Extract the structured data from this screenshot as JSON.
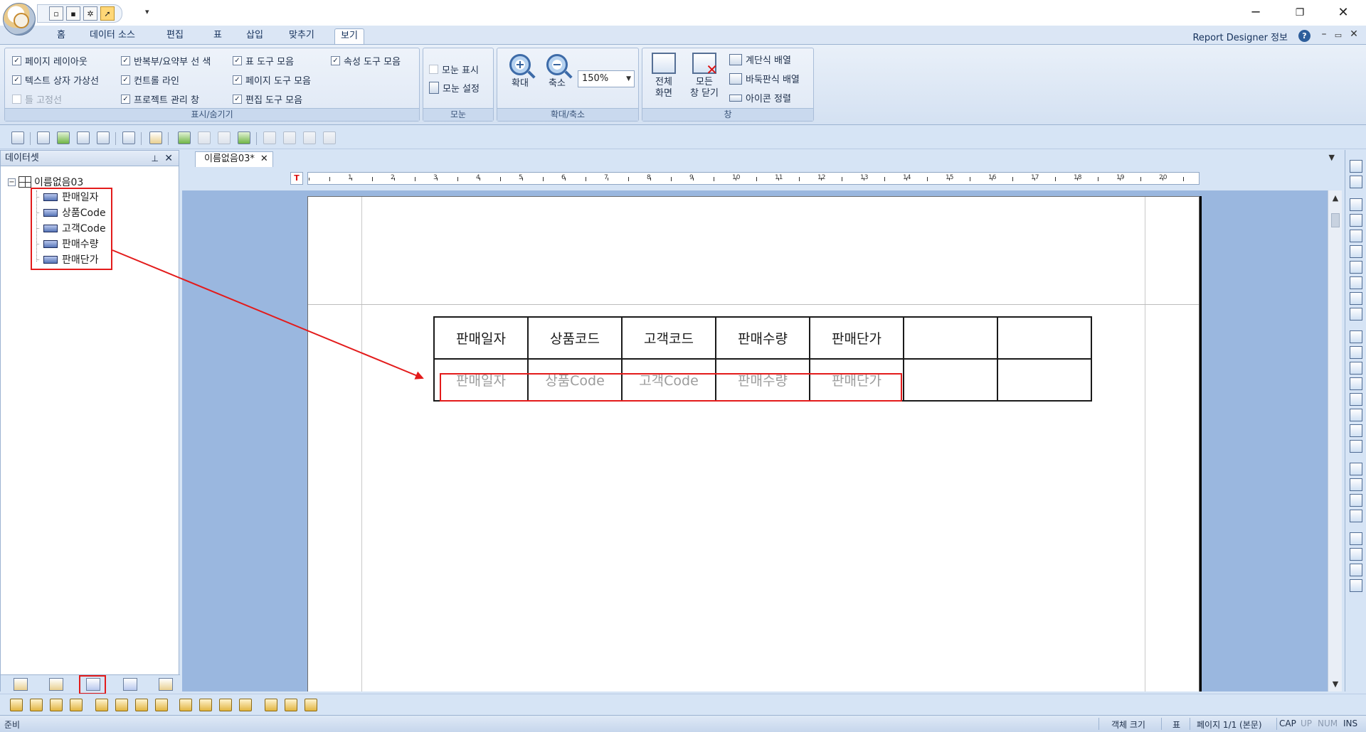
{
  "ribbon": {
    "tabs": [
      "홈",
      "데이터 소스",
      "편집",
      "표",
      "삽입",
      "맞추기",
      "보기"
    ],
    "active_tab": "보기",
    "right_info": "Report Designer 정보",
    "groups": {
      "show_hide": {
        "label": "표시/숨기기",
        "checks": [
          {
            "label": "페이지 레이아웃",
            "checked": true
          },
          {
            "label": "텍스트 상자 가상선",
            "checked": true
          },
          {
            "label": "틀 고정선",
            "checked": false
          },
          {
            "label": "반복부/요약부 선 색",
            "checked": true
          },
          {
            "label": "컨트롤 라인",
            "checked": true
          },
          {
            "label": "프로젝트 관리 창",
            "checked": true
          },
          {
            "label": "표 도구 모음",
            "checked": true
          },
          {
            "label": "페이지 도구 모음",
            "checked": true
          },
          {
            "label": "편집 도구 모음",
            "checked": true
          },
          {
            "label": "속성 도구 모음",
            "checked": true
          }
        ]
      },
      "grid": {
        "label": "모눈",
        "show": "모눈 표시",
        "settings": "모눈 설정"
      },
      "zoom": {
        "label": "확대/축소",
        "zoom_in": "확대",
        "zoom_out": "축소",
        "value": "150%"
      },
      "window": {
        "label": "창",
        "fullscreen_1": "전체",
        "fullscreen_2": "화면",
        "close_all_1": "모든",
        "close_all_2": "창 닫기",
        "cascade": "계단식 배열",
        "tile": "바둑판식 배열",
        "arrange_icons": "아이콘 정렬"
      }
    }
  },
  "left_panel": {
    "title": "데이터셋",
    "root": "이름없음03",
    "fields": [
      "판매일자",
      "상품Code",
      "고객Code",
      "판매수량",
      "판매단가"
    ]
  },
  "document": {
    "tab_label": "이름없음03*",
    "ruler_corner": "T",
    "ruler_numbers": [
      "1",
      "2",
      "3",
      "4",
      "5",
      "6",
      "7",
      "8",
      "9",
      "10",
      "11",
      "12",
      "13",
      "14",
      "15",
      "16",
      "17",
      "18",
      "19",
      "20"
    ],
    "table": {
      "headers": [
        "판매일자",
        "상품코드",
        "고객코드",
        "판매수량",
        "판매단가",
        "",
        ""
      ],
      "data": [
        "판매일자",
        "상품Code",
        "고객Code",
        "판매수량",
        "판매단가",
        "",
        ""
      ]
    }
  },
  "statusbar": {
    "left": "준비",
    "object_size": "객체 크기",
    "table": "표",
    "page": "페이지 1/1 (본문)",
    "cap": "CAP",
    "up": "UP",
    "num": "NUM",
    "ins": "INS"
  },
  "colors": {
    "highlight": "#e31b1b",
    "canvas_bg": "#9ab7df",
    "ribbon_bg": "#d6e4f5"
  }
}
